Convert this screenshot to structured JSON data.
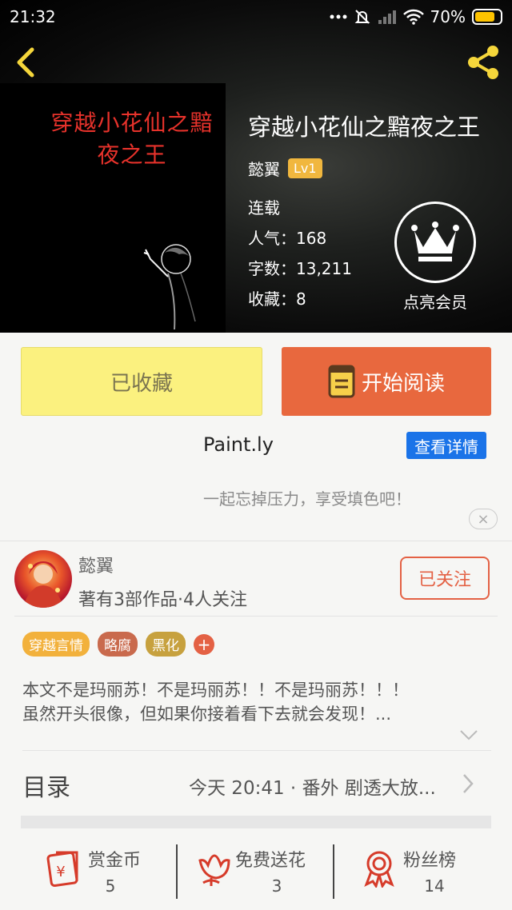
{
  "status_bar": {
    "time": "21:32",
    "battery": "70%"
  },
  "book": {
    "cover_title": "穿越小花仙之黯夜之王",
    "title": "穿越小花仙之黯夜之王",
    "author": "懿翼",
    "level": "Lv1",
    "status": "连载",
    "popularity": "人气：168",
    "word_count": "字数：13,211",
    "favorites": "收藏：8"
  },
  "vip": {
    "label": "点亮会员"
  },
  "buttons": {
    "collected": "已收藏",
    "read": "开始阅读"
  },
  "ad": {
    "name": "Paint.ly",
    "detail_button": "查看详情",
    "slogan": "一起忘掉压力，享受填色吧！",
    "close_symbol": "×"
  },
  "author_card": {
    "name": "懿翼",
    "info": "著有3部作品·4人关注",
    "follow_label": "已关注"
  },
  "tags": [
    {
      "label": "穿越言情",
      "color": "#f2b13c"
    },
    {
      "label": "略腐",
      "color": "#c96a4d"
    },
    {
      "label": "黑化",
      "color": "#c7a13e"
    }
  ],
  "tag_add": "+",
  "description": {
    "line1": "本文不是玛丽苏！不是玛丽苏！！不是玛丽苏！！！",
    "line2": "虽然开头很像，但如果你接着看下去就会发现！..."
  },
  "toc": {
    "label": "目录",
    "latest": "今天 20:41 · 番外 剧透大放..."
  },
  "actions": [
    {
      "label": "赏金币",
      "count": "5",
      "icon": "coin-envelope-icon"
    },
    {
      "label": "免费送花",
      "count": "3",
      "icon": "flower-icon"
    },
    {
      "label": "粉丝榜",
      "count": "14",
      "icon": "ribbon-medal-icon"
    }
  ],
  "colors": {
    "accent": "#e8683e",
    "collected_bg": "#fbf17f",
    "link_blue": "#1a73e8",
    "level_badge": "#f1b73e"
  }
}
